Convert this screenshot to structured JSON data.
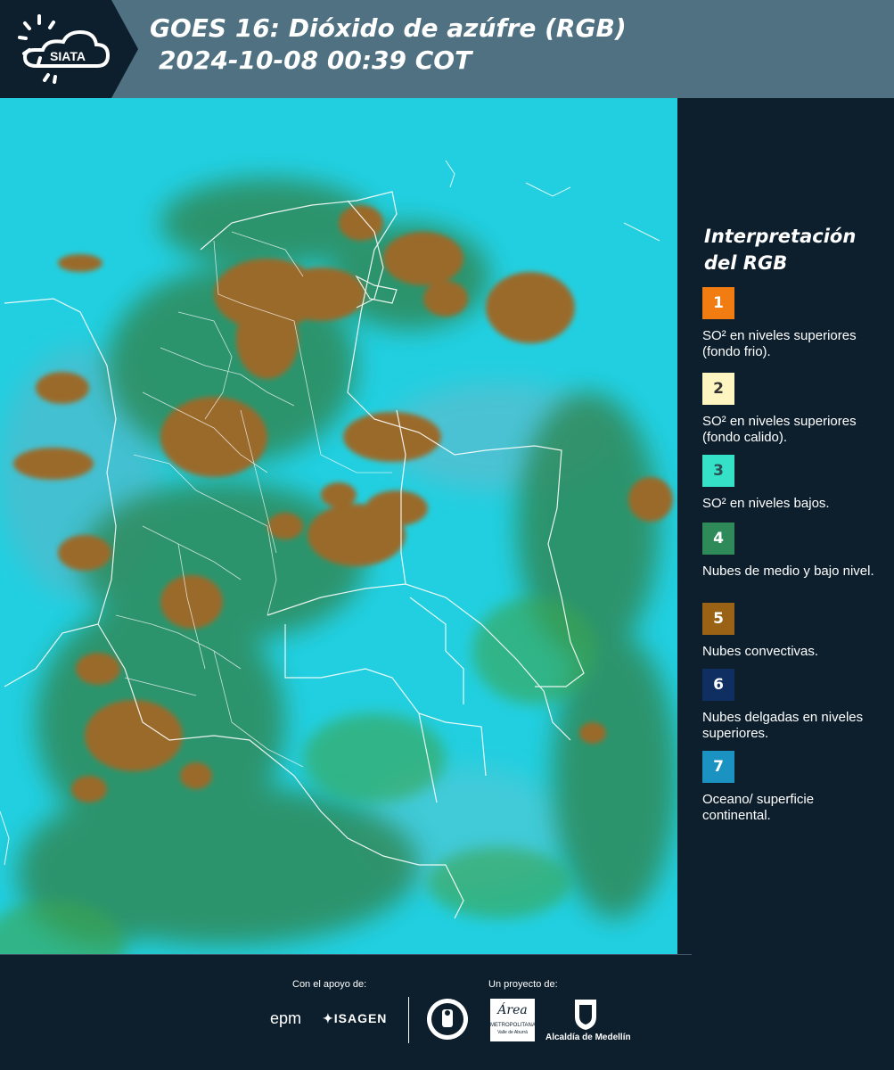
{
  "header": {
    "logo_text": "SIATA",
    "title_line1": "GOES 16: Dióxido de azúfre (RGB)",
    "title_line2": "2024-10-08 00:39 COT"
  },
  "legend": {
    "title": "Interpretación del RGB",
    "items": [
      {
        "number": "1",
        "color": "#f07c12",
        "text_color": "#ffffff",
        "label": "SO² en niveles superiores (fondo frio)."
      },
      {
        "number": "2",
        "color": "#fdf6c0",
        "text_color": "#333333",
        "label": "SO² en niveles superiores (fondo calido)."
      },
      {
        "number": "3",
        "color": "#35e2c8",
        "text_color": "#2a4f55",
        "label": "SO² en niveles bajos."
      },
      {
        "number": "4",
        "color": "#2f8a5a",
        "text_color": "#ffffff",
        "label": "Nubes de medio y bajo nivel."
      },
      {
        "number": "5",
        "color": "#9a6214",
        "text_color": "#ffffff",
        "label": "Nubes convectivas."
      },
      {
        "number": "6",
        "color": "#0f2f63",
        "text_color": "#ffffff",
        "label": "Nubes delgadas en niveles superiores."
      },
      {
        "number": "7",
        "color": "#1a93c2",
        "text_color": "#ffffff",
        "label": "Oceano/ superficie continental."
      }
    ]
  },
  "footer": {
    "support_label": "Con el apoyo de:",
    "project_label": "Un proyecto de:",
    "sponsor_epm": "epm",
    "sponsor_isagen": "ISAGEN",
    "sponsor_metro": "Área",
    "sponsor_metro_sub": "METROPOLITANA",
    "sponsor_metro_sub2": "Valle de Aburrá",
    "sponsor_alcaldia": "Alcaldía de Medellín"
  },
  "colors": {
    "background": "#0d1f2d",
    "header": "#507181",
    "map_ocean": "#22cfe0",
    "map_land": "#2f8a5a",
    "map_convective": "#9a6a2c"
  }
}
